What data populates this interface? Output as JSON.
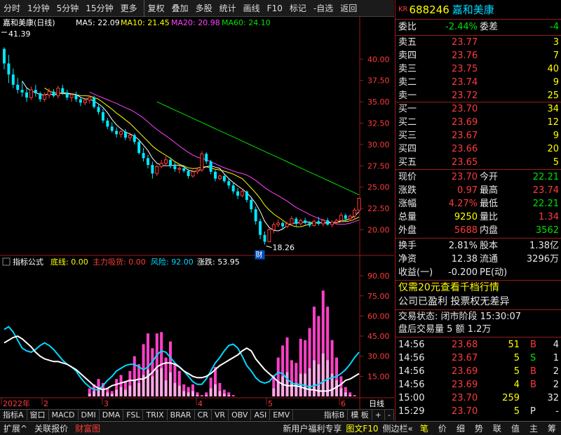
{
  "toolbar": {
    "items": [
      "分时",
      "1分钟",
      "5分钟",
      "15分钟",
      "更多",
      "复权",
      "叠加",
      "多股",
      "统计",
      "画线",
      "F10",
      "标记",
      "-自选",
      "返回"
    ]
  },
  "stock": {
    "code_prefix": "KR",
    "code": "688246",
    "name": "嘉和美康"
  },
  "kline": {
    "title": "嘉和美康(日线)",
    "ma5": "MA5: 22.09",
    "ma10": "MA10: 21.45",
    "ma20": "MA20: 20.98",
    "ma60": "MA60: 24.10",
    "max_label": "41.39",
    "min_label": "18.26",
    "cai_label": "财",
    "axis_labels": [
      "40.00",
      "37.50",
      "35.00",
      "32.50",
      "30.00",
      "27.50",
      "25.00",
      "22.50",
      "20.00"
    ],
    "colors": {
      "ma5": "#ffffff",
      "ma10": "#ffff00",
      "ma20": "#ff40ff",
      "ma60": "#00e000",
      "up": "#ff3b3b",
      "down": "#00e8ff"
    }
  },
  "indicator": {
    "title": "指标公式",
    "bottom_line": "底线: 0.00",
    "main_suck": "主力吸货: 0.00",
    "risk": "风险: 92.00",
    "drop": "涨跌: 53.95",
    "axis_labels": [
      "90.00",
      "75.00",
      "60.00",
      "45.00",
      "30.00",
      "15.00"
    ]
  },
  "xaxis": {
    "labels": [
      "2022年",
      "2",
      "3",
      "4",
      "5",
      "6"
    ],
    "right": "日线"
  },
  "chart_data": [
    {
      "type": "candlestick",
      "ylim": [
        17,
        42
      ],
      "y_ticks": [
        20,
        22.5,
        25,
        27.5,
        30,
        32.5,
        35,
        37.5,
        40
      ],
      "ohlc": [
        [
          41.2,
          41.39,
          38.8,
          39.5
        ],
        [
          39.5,
          40.5,
          37.2,
          38.2
        ],
        [
          38.2,
          38.9,
          36.6,
          37.0
        ],
        [
          37.0,
          37.8,
          36.0,
          36.4
        ],
        [
          36.4,
          37.4,
          35.6,
          36.1
        ],
        [
          36.1,
          36.6,
          35.0,
          35.5
        ],
        [
          35.5,
          36.8,
          35.2,
          36.4
        ],
        [
          36.4,
          37.0,
          35.6,
          36.0
        ],
        [
          36.0,
          36.2,
          35.0,
          35.3
        ],
        [
          35.3,
          36.1,
          35.0,
          35.8
        ],
        [
          35.8,
          36.6,
          35.4,
          36.2
        ],
        [
          36.2,
          36.5,
          35.5,
          35.7
        ],
        [
          35.7,
          36.9,
          35.4,
          36.6
        ],
        [
          36.6,
          37.0,
          35.8,
          36.1
        ],
        [
          36.1,
          36.4,
          35.2,
          35.5
        ],
        [
          35.5,
          36.0,
          35.0,
          35.8
        ],
        [
          35.8,
          36.2,
          35.0,
          35.3
        ],
        [
          35.3,
          35.5,
          34.5,
          34.9
        ],
        [
          34.9,
          35.4,
          34.6,
          35.2
        ],
        [
          35.2,
          35.8,
          34.8,
          35.5
        ],
        [
          35.5,
          35.7,
          34.2,
          34.4
        ],
        [
          34.4,
          34.8,
          33.5,
          33.8
        ],
        [
          33.8,
          34.2,
          32.5,
          32.8
        ],
        [
          32.8,
          33.1,
          31.8,
          32.1
        ],
        [
          32.1,
          32.6,
          31.4,
          31.6
        ],
        [
          31.6,
          32.0,
          30.8,
          31.2
        ],
        [
          31.2,
          31.7,
          30.8,
          31.5
        ],
        [
          31.5,
          31.8,
          30.5,
          30.8
        ],
        [
          30.8,
          31.4,
          30.4,
          31.1
        ],
        [
          31.1,
          31.3,
          30.0,
          30.3
        ],
        [
          30.3,
          30.6,
          28.8,
          29.0
        ],
        [
          29.0,
          29.6,
          28.0,
          28.4
        ],
        [
          28.4,
          28.8,
          27.2,
          27.6
        ],
        [
          27.6,
          28.0,
          26.0,
          26.6
        ],
        [
          26.6,
          27.6,
          26.3,
          27.4
        ],
        [
          27.4,
          28.2,
          27.2,
          27.8
        ],
        [
          27.8,
          28.6,
          27.6,
          28.2
        ],
        [
          28.2,
          28.5,
          27.2,
          27.5
        ],
        [
          27.5,
          27.9,
          26.8,
          27.1
        ],
        [
          27.1,
          27.5,
          26.6,
          27.2
        ],
        [
          27.2,
          27.6,
          26.7,
          26.9
        ],
        [
          26.9,
          27.1,
          26.0,
          26.3
        ],
        [
          26.3,
          27.0,
          26.1,
          26.8
        ],
        [
          26.8,
          27.3,
          26.5,
          27.0
        ],
        [
          27.0,
          29.2,
          26.8,
          28.9
        ],
        [
          28.9,
          29.1,
          27.7,
          28.0
        ],
        [
          28.0,
          28.2,
          26.5,
          26.8
        ],
        [
          26.8,
          27.0,
          25.7,
          26.0
        ],
        [
          26.0,
          26.5,
          25.8,
          26.3
        ],
        [
          26.3,
          26.6,
          25.5,
          25.7
        ],
        [
          25.7,
          26.0,
          24.8,
          25.2
        ],
        [
          25.2,
          25.6,
          24.2,
          24.5
        ],
        [
          24.5,
          24.9,
          23.6,
          24.0
        ],
        [
          24.0,
          24.8,
          23.8,
          24.5
        ],
        [
          24.5,
          24.6,
          23.2,
          23.5
        ],
        [
          23.5,
          23.9,
          22.0,
          22.4
        ],
        [
          22.4,
          22.7,
          20.6,
          21.0
        ],
        [
          21.0,
          21.3,
          18.9,
          19.4
        ],
        [
          19.4,
          19.8,
          18.26,
          18.6
        ],
        [
          18.6,
          20.2,
          18.5,
          20.0
        ],
        [
          20.0,
          20.9,
          19.6,
          20.6
        ],
        [
          20.6,
          21.2,
          20.3,
          20.8
        ],
        [
          20.8,
          21.0,
          20.1,
          20.4
        ],
        [
          20.4,
          20.9,
          20.2,
          20.7
        ],
        [
          20.7,
          21.6,
          20.5,
          21.3
        ],
        [
          21.3,
          21.5,
          20.4,
          20.7
        ],
        [
          20.7,
          21.3,
          20.5,
          21.1
        ],
        [
          21.1,
          21.4,
          20.6,
          20.8
        ],
        [
          20.8,
          21.0,
          20.3,
          20.5
        ],
        [
          20.5,
          21.2,
          20.4,
          21.0
        ],
        [
          21.0,
          21.5,
          20.5,
          20.7
        ],
        [
          20.7,
          21.3,
          20.4,
          21.1
        ],
        [
          21.1,
          21.4,
          20.5,
          20.6
        ],
        [
          20.6,
          21.1,
          20.3,
          20.9
        ],
        [
          20.9,
          21.3,
          20.6,
          21.1
        ],
        [
          21.1,
          22.0,
          20.9,
          21.7
        ],
        [
          21.7,
          21.9,
          21.0,
          21.3
        ],
        [
          21.3,
          21.8,
          21.0,
          21.6
        ],
        [
          21.6,
          22.6,
          21.2,
          22.3
        ],
        [
          22.3,
          23.74,
          22.21,
          23.7
        ]
      ]
    },
    {
      "type": "bar+line",
      "ylim": [
        0,
        100
      ],
      "y_ticks": [
        15,
        30,
        45,
        60,
        75,
        90
      ],
      "bars": [
        0,
        0,
        0,
        0,
        0,
        0,
        0,
        0,
        0,
        0,
        0,
        0,
        0,
        0,
        0,
        0,
        0,
        0,
        0,
        6,
        9,
        13,
        10,
        6,
        4,
        13,
        16,
        11,
        19,
        30,
        24,
        39,
        47,
        36,
        47,
        48,
        29,
        41,
        24,
        19,
        9,
        7,
        9,
        3,
        1,
        3,
        14,
        22,
        10,
        5,
        3,
        1,
        0,
        0,
        0,
        0,
        0,
        0,
        0,
        0,
        16,
        29,
        38,
        44,
        27,
        25,
        43,
        42,
        51,
        67,
        60,
        79,
        67,
        42,
        29,
        15,
        7,
        3,
        1,
        0,
        0,
        0,
        0,
        0,
        0,
        0,
        0,
        0,
        0
      ],
      "bars_fill": [
        0,
        0,
        0,
        0,
        0,
        0,
        0,
        0,
        0,
        0,
        0,
        0,
        0,
        0,
        0,
        0,
        0,
        0,
        0,
        2,
        4,
        6,
        6,
        3,
        2,
        5,
        7,
        5,
        8,
        12,
        10,
        16,
        20,
        15,
        20,
        21,
        12,
        18,
        10,
        8,
        4,
        3,
        4,
        1,
        0,
        1,
        6,
        9,
        4,
        2,
        1,
        0,
        0,
        0,
        0,
        0,
        0,
        0,
        0,
        0,
        6,
        11,
        15,
        18,
        11,
        10,
        17,
        17,
        21,
        27,
        24,
        32,
        27,
        17,
        12,
        6,
        3,
        1,
        0,
        0,
        0,
        0,
        0,
        0,
        0,
        0,
        0,
        0,
        0
      ],
      "white": [
        40,
        42,
        44,
        45,
        43,
        40,
        37,
        33,
        30,
        28,
        27,
        26,
        26,
        25,
        24,
        22,
        20,
        17,
        14,
        11,
        8,
        6,
        5,
        6,
        8,
        9,
        10,
        11,
        12,
        12,
        13,
        13,
        15,
        18,
        22,
        24,
        25,
        25,
        24,
        22,
        19,
        17,
        15,
        14,
        14,
        15,
        17,
        20,
        23,
        25,
        27,
        29,
        31,
        34,
        36,
        34,
        28,
        24,
        20,
        17,
        14,
        11,
        9,
        8,
        8,
        8,
        7,
        6,
        5,
        5,
        4,
        4,
        4,
        5,
        7,
        9,
        12,
        13,
        15,
        17,
        20,
        23,
        26,
        29,
        31,
        34,
        37,
        40,
        45,
        51
      ],
      "cyan": [
        50,
        52,
        48,
        42,
        36,
        34,
        33,
        35,
        38,
        40,
        38,
        35,
        31,
        27,
        24,
        22,
        19,
        14,
        10,
        7,
        5,
        5,
        8,
        12,
        15,
        19,
        21,
        23,
        24,
        24,
        22,
        20,
        22,
        26,
        31,
        34,
        33,
        29,
        25,
        22,
        19,
        15,
        11,
        9,
        9,
        13,
        19,
        25,
        29,
        34,
        38,
        39,
        36,
        30,
        23,
        19,
        14,
        11,
        10,
        11,
        15,
        18,
        17,
        13,
        10,
        9,
        9,
        8,
        7,
        8,
        9,
        11,
        13,
        14,
        15,
        17,
        20,
        24,
        29,
        33,
        36,
        38,
        42,
        46,
        51,
        57,
        62,
        70,
        78,
        92
      ]
    }
  ],
  "quote": {
    "weibi_label": "委比",
    "weibi": "-2.44%",
    "weicha_label": "委差",
    "weicha": "-4",
    "asks": [
      {
        "label": "卖五",
        "price": "23.77",
        "vol": "3"
      },
      {
        "label": "卖四",
        "price": "23.76",
        "vol": "7"
      },
      {
        "label": "卖三",
        "price": "23.75",
        "vol": "40"
      },
      {
        "label": "卖二",
        "price": "23.74",
        "vol": "9"
      },
      {
        "label": "卖一",
        "price": "23.72",
        "vol": "25"
      }
    ],
    "bids": [
      {
        "label": "买一",
        "price": "23.70",
        "vol": "34"
      },
      {
        "label": "买二",
        "price": "23.69",
        "vol": "12"
      },
      {
        "label": "买三",
        "price": "23.67",
        "vol": "9"
      },
      {
        "label": "买四",
        "price": "23.66",
        "vol": "20"
      },
      {
        "label": "买五",
        "price": "23.65",
        "vol": "5"
      }
    ],
    "stats": [
      {
        "l1": "现价",
        "v1": "23.70",
        "c1": "red",
        "l2": "今开",
        "v2": "22.21",
        "c2": "green"
      },
      {
        "l1": "涨跌",
        "v1": "0.97",
        "c1": "red",
        "l2": "最高",
        "v2": "23.74",
        "c2": "red"
      },
      {
        "l1": "涨幅",
        "v1": "4.27%",
        "c1": "red",
        "l2": "最低",
        "v2": "22.21",
        "c2": "green"
      },
      {
        "l1": "总量",
        "v1": "9250",
        "c1": "yellow",
        "l2": "量比",
        "v2": "1.34",
        "c2": "red"
      },
      {
        "l1": "外盘",
        "v1": "5688",
        "c1": "red",
        "l2": "内盘",
        "v2": "3562",
        "c2": "green"
      }
    ],
    "stats2": [
      {
        "l1": "换手",
        "v1": "2.81%",
        "l2": "股本",
        "v2": "1.38亿"
      },
      {
        "l1": "净资",
        "v1": "12.38",
        "l2": "流通",
        "v2": "3296万"
      },
      {
        "l1": "收益(一)",
        "v1": "-0.200",
        "l2": "PE(动)",
        "v2": ""
      }
    ],
    "promo": "仅需20元查看千档行情",
    "info1": "公司已盈利 投票权无差异",
    "trade_status": "交易状态: 闭市阶段 15:30:07",
    "after_hours": "盘后交易量 5 额 1.2万",
    "ticks": [
      {
        "t": "14:56",
        "p": "23.68",
        "v": "51",
        "s": "B",
        "n": "4",
        "sc": "red"
      },
      {
        "t": "14:56",
        "p": "23.67",
        "v": "5",
        "s": "S",
        "n": "1",
        "sc": "green"
      },
      {
        "t": "14:56",
        "p": "23.69",
        "v": "5",
        "s": "B",
        "n": "2",
        "sc": "red"
      },
      {
        "t": "14:56",
        "p": "23.69",
        "v": "4",
        "s": "B",
        "n": "2",
        "sc": "red"
      },
      {
        "t": "15:00",
        "p": "23.70",
        "v": "259",
        "s": "",
        "n": "32",
        "sc": "white"
      },
      {
        "t": "15:29",
        "p": "23.70",
        "v": "5",
        "s": "P",
        "n": "-",
        "sc": "white"
      }
    ]
  },
  "tabs": [
    "指标A",
    "窗口",
    "MACD",
    "DMI",
    "DMA",
    "FSL",
    "TRIX",
    "BRAR",
    "CR",
    "VR",
    "OBV",
    "ASI",
    "EMV",
    "指标B",
    "模 板",
    "+",
    "-"
  ],
  "bottom": {
    "left": [
      "扩展^",
      "关联报价",
      "财富图"
    ],
    "right": [
      "新用户福利专享",
      "图文F10",
      "侧边栏«"
    ],
    "panel": [
      "笔",
      "价",
      "细",
      "势",
      "联",
      "值",
      "主",
      "筹"
    ]
  }
}
